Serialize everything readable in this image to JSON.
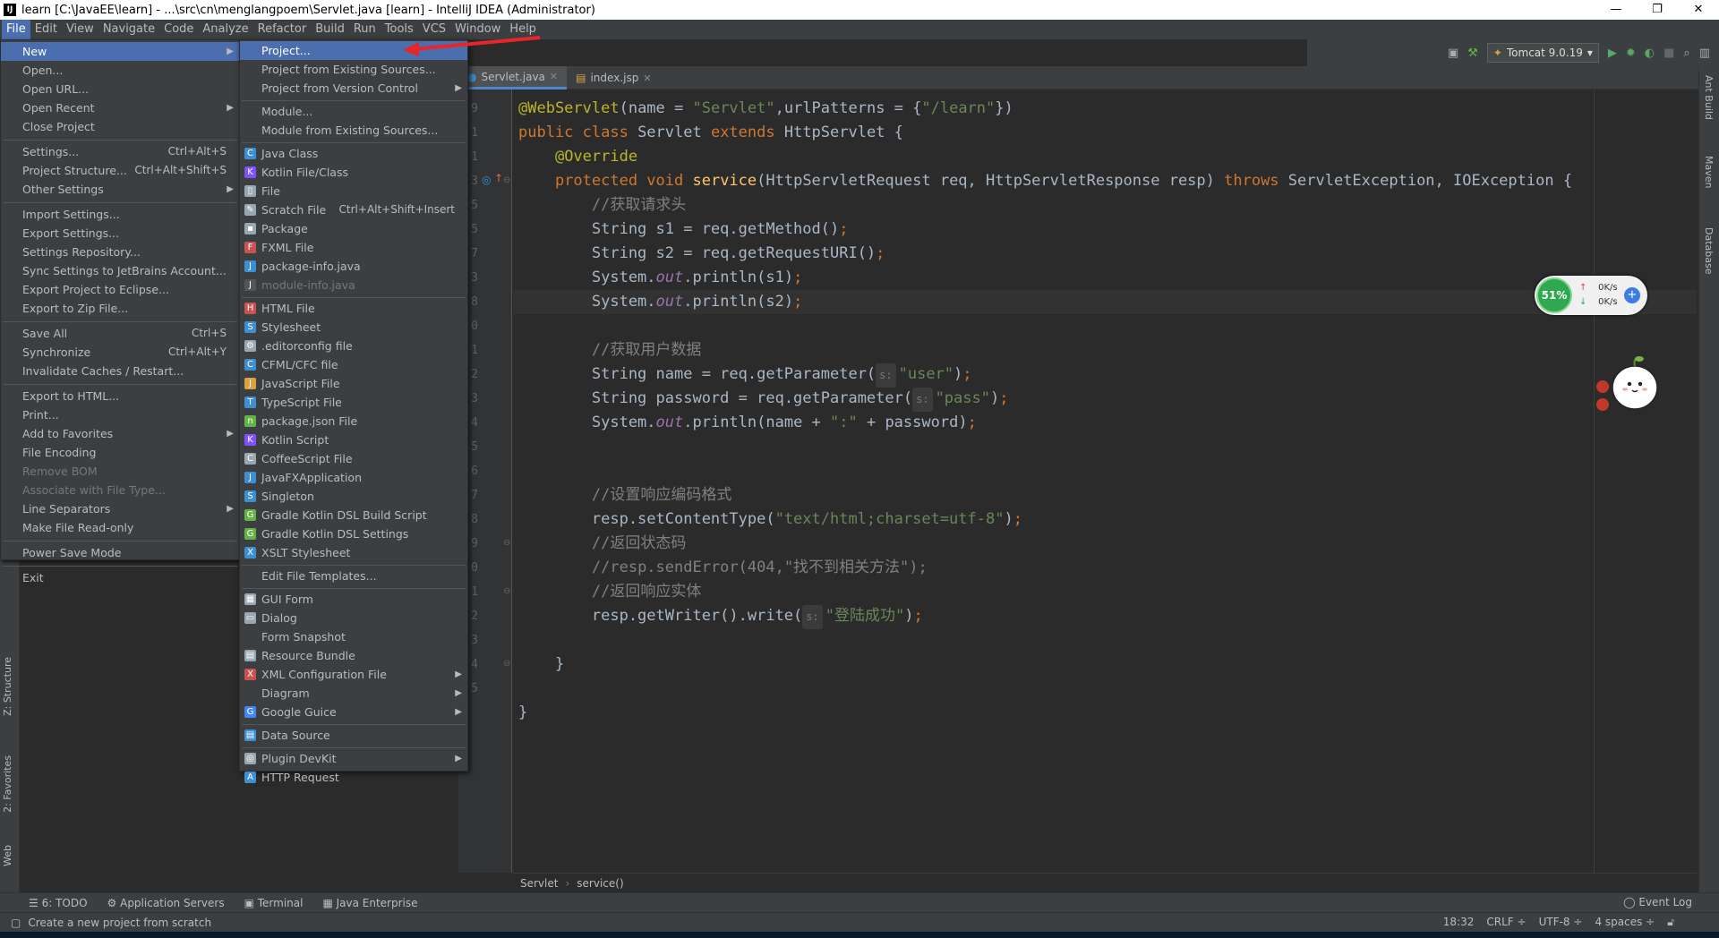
{
  "window": {
    "title": "learn [C:\\JavaEE\\learn] - ...\\src\\cn\\menglangpoem\\Servlet.java [learn] - IntelliJ IDEA (Administrator)",
    "app_icon": "IJ",
    "controls": [
      "—",
      "❐",
      "✕"
    ]
  },
  "menubar": [
    "File",
    "Edit",
    "View",
    "Navigate",
    "Code",
    "Analyze",
    "Refactor",
    "Build",
    "Run",
    "Tools",
    "VCS",
    "Window",
    "Help"
  ],
  "run_config": "Tomcat 9.0.19",
  "tabs": [
    {
      "label": "Servlet.java",
      "selected": true
    },
    {
      "label": "index.jsp",
      "selected": false
    }
  ],
  "file_menu": [
    {
      "label": "New",
      "submenu": true,
      "highlight": true
    },
    {
      "label": "Open..."
    },
    {
      "label": "Open URL..."
    },
    {
      "label": "Open Recent",
      "submenu": true
    },
    {
      "label": "Close Project"
    },
    {
      "sep": true
    },
    {
      "label": "Settings...",
      "shortcut": "Ctrl+Alt+S"
    },
    {
      "label": "Project Structure...",
      "shortcut": "Ctrl+Alt+Shift+S"
    },
    {
      "label": "Other Settings",
      "submenu": true
    },
    {
      "sep": true
    },
    {
      "label": "Import Settings..."
    },
    {
      "label": "Export Settings..."
    },
    {
      "label": "Settings Repository..."
    },
    {
      "label": "Sync Settings to JetBrains Account..."
    },
    {
      "label": "Export Project to Eclipse..."
    },
    {
      "label": "Export to Zip File..."
    },
    {
      "sep": true
    },
    {
      "label": "Save All",
      "shortcut": "Ctrl+S"
    },
    {
      "label": "Synchronize",
      "shortcut": "Ctrl+Alt+Y"
    },
    {
      "label": "Invalidate Caches / Restart..."
    },
    {
      "sep": true
    },
    {
      "label": "Export to HTML..."
    },
    {
      "label": "Print..."
    },
    {
      "label": "Add to Favorites",
      "submenu": true
    },
    {
      "label": "File Encoding"
    },
    {
      "label": "Remove BOM",
      "disabled": true
    },
    {
      "label": "Associate with File Type...",
      "disabled": true
    },
    {
      "label": "Line Separators",
      "submenu": true
    },
    {
      "label": "Make File Read-only"
    },
    {
      "sep": true
    },
    {
      "label": "Power Save Mode"
    },
    {
      "sep": true
    },
    {
      "label": "Exit"
    }
  ],
  "new_menu": [
    {
      "label": "Project...",
      "highlight": true
    },
    {
      "label": "Project from Existing Sources..."
    },
    {
      "label": "Project from Version Control",
      "submenu": true
    },
    {
      "sep": true
    },
    {
      "label": "Module..."
    },
    {
      "label": "Module from Existing Sources..."
    },
    {
      "sep": true
    },
    {
      "label": "Java Class",
      "icon": "C",
      "color": "#3d8fd1"
    },
    {
      "label": "Kotlin File/Class",
      "icon": "K",
      "color": "#7f52ff"
    },
    {
      "label": "File",
      "icon": "▯",
      "color": "#9aa7b0"
    },
    {
      "label": "Scratch File",
      "shortcut": "Ctrl+Alt+Shift+Insert",
      "icon": "✎",
      "color": "#9aa7b0"
    },
    {
      "label": "Package",
      "icon": "▪",
      "color": "#9aa7b0"
    },
    {
      "label": "FXML File",
      "icon": "F",
      "color": "#c75450"
    },
    {
      "label": "package-info.java",
      "icon": "J",
      "color": "#3d8fd1"
    },
    {
      "label": "module-info.java",
      "disabled": true,
      "icon": "J",
      "color": "#555"
    },
    {
      "sep": true
    },
    {
      "label": "HTML File",
      "icon": "H",
      "color": "#c75450"
    },
    {
      "label": "Stylesheet",
      "icon": "S",
      "color": "#3d8fd1"
    },
    {
      "label": ".editorconfig file",
      "icon": "⚙",
      "color": "#9aa7b0"
    },
    {
      "label": "CFML/CFC file",
      "icon": "C",
      "color": "#3d8fd1"
    },
    {
      "label": "JavaScript File",
      "icon": "J",
      "color": "#d9a343"
    },
    {
      "label": "TypeScript File",
      "icon": "T",
      "color": "#3d8fd1"
    },
    {
      "label": "package.json File",
      "icon": "n",
      "color": "#62b543"
    },
    {
      "label": "Kotlin Script",
      "icon": "K",
      "color": "#7f52ff"
    },
    {
      "label": "CoffeeScript File",
      "icon": "C",
      "color": "#9aa7b0"
    },
    {
      "label": "JavaFXApplication",
      "icon": "J",
      "color": "#3d8fd1"
    },
    {
      "label": "Singleton",
      "icon": "S",
      "color": "#3d8fd1"
    },
    {
      "label": "Gradle Kotlin DSL Build Script",
      "icon": "G",
      "color": "#62b543"
    },
    {
      "label": "Gradle Kotlin DSL Settings",
      "icon": "G",
      "color": "#62b543"
    },
    {
      "label": "XSLT Stylesheet",
      "icon": "X",
      "color": "#3d8fd1"
    },
    {
      "sep": true
    },
    {
      "label": "Edit File Templates..."
    },
    {
      "sep": true
    },
    {
      "label": "GUI Form",
      "icon": "▦",
      "color": "#9aa7b0"
    },
    {
      "label": "Dialog",
      "icon": "▭",
      "color": "#9aa7b0"
    },
    {
      "label": "Form Snapshot"
    },
    {
      "label": "Resource Bundle",
      "icon": "▤",
      "color": "#9aa7b0"
    },
    {
      "label": "XML Configuration File",
      "submenu": true,
      "icon": "X",
      "color": "#c75450"
    },
    {
      "label": "Diagram",
      "submenu": true
    },
    {
      "label": "Google Guice",
      "submenu": true,
      "icon": "G",
      "color": "#4285f4"
    },
    {
      "sep": true
    },
    {
      "label": "Data Source",
      "icon": "▤",
      "color": "#3d8fd1"
    },
    {
      "sep": true
    },
    {
      "label": "Plugin DevKit",
      "submenu": true,
      "icon": "◎",
      "color": "#9aa7b0"
    },
    {
      "label": "HTTP Request",
      "icon": "A",
      "color": "#3d8fd1"
    }
  ],
  "editor": {
    "line_numbers": [
      "9",
      "1",
      "1",
      "3",
      "5",
      "5",
      "7",
      "3",
      "8",
      "0",
      "1",
      "2",
      "3",
      "4",
      "5",
      "6",
      "7",
      "8",
      "9",
      "0",
      "1",
      "2",
      "3",
      "4",
      "5"
    ],
    "lines": [
      {
        "tokens": [
          [
            "ann",
            "@WebServlet"
          ],
          [
            "pl",
            "(name = "
          ],
          [
            "str",
            "\"Servlet\""
          ],
          [
            "pl",
            ",urlPatterns = {"
          ],
          [
            "str",
            "\"/learn\""
          ],
          [
            "pl",
            "})"
          ]
        ]
      },
      {
        "tokens": [
          [
            "kw",
            "public class "
          ],
          [
            "pl",
            "Servlet "
          ],
          [
            "kw",
            "extends "
          ],
          [
            "pl",
            "HttpServlet {"
          ]
        ]
      },
      {
        "tokens": [
          [
            "pl",
            "    "
          ],
          [
            "ann",
            "@Override"
          ]
        ]
      },
      {
        "tokens": [
          [
            "pl",
            "    "
          ],
          [
            "kw",
            "protected void "
          ],
          [
            "fn",
            "service"
          ],
          [
            "pl",
            "(HttpServletRequest req, HttpServletResponse resp) "
          ],
          [
            "kw",
            "throws "
          ],
          [
            "pl",
            "ServletException, IOException {"
          ]
        ]
      },
      {
        "tokens": [
          [
            "pl",
            "        "
          ],
          [
            "cm",
            "//获取请求头"
          ]
        ]
      },
      {
        "tokens": [
          [
            "pl",
            "        String s1 = req.getMethod()"
          ],
          [
            "kw",
            ";"
          ]
        ]
      },
      {
        "tokens": [
          [
            "pl",
            "        String s2 = req.getRequestURI()"
          ],
          [
            "kw",
            ";"
          ]
        ]
      },
      {
        "tokens": [
          [
            "pl",
            "        System."
          ],
          [
            "it",
            "out"
          ],
          [
            "pl",
            ".println(s1)"
          ],
          [
            "kw",
            ";"
          ]
        ]
      },
      {
        "tokens": [
          [
            "pl",
            "        System."
          ],
          [
            "it",
            "out"
          ],
          [
            "pl",
            ".println(s2)"
          ],
          [
            "kw",
            ";"
          ]
        ],
        "current": true
      },
      {
        "tokens": []
      },
      {
        "tokens": [
          [
            "pl",
            "        "
          ],
          [
            "cm",
            "//获取用户数据"
          ]
        ]
      },
      {
        "tokens": [
          [
            "pl",
            "        String name = req.getParameter("
          ],
          [
            "hint",
            "s:"
          ],
          [
            "str",
            "\"user\""
          ],
          [
            "pl",
            ")"
          ],
          [
            "kw",
            ";"
          ]
        ]
      },
      {
        "tokens": [
          [
            "pl",
            "        String password = req.getParameter("
          ],
          [
            "hint",
            "s:"
          ],
          [
            "str",
            "\"pass\""
          ],
          [
            "pl",
            ")"
          ],
          [
            "kw",
            ";"
          ]
        ]
      },
      {
        "tokens": [
          [
            "pl",
            "        System."
          ],
          [
            "it",
            "out"
          ],
          [
            "pl",
            ".println(name + "
          ],
          [
            "str",
            "\":\""
          ],
          [
            "pl",
            " + password)"
          ],
          [
            "kw",
            ";"
          ]
        ]
      },
      {
        "tokens": []
      },
      {
        "tokens": []
      },
      {
        "tokens": [
          [
            "pl",
            "        "
          ],
          [
            "cm",
            "//设置响应编码格式"
          ]
        ]
      },
      {
        "tokens": [
          [
            "pl",
            "        resp.setContentType("
          ],
          [
            "str",
            "\"text/html;charset=utf-8\""
          ],
          [
            "pl",
            ")"
          ],
          [
            "kw",
            ";"
          ]
        ]
      },
      {
        "tokens": [
          [
            "pl",
            "        "
          ],
          [
            "cm",
            "//返回状态码"
          ]
        ]
      },
      {
        "tokens": [
          [
            "pl",
            "        "
          ],
          [
            "cm",
            "//resp.sendError(404,\"找不到相关方法\");"
          ]
        ]
      },
      {
        "tokens": [
          [
            "pl",
            "        "
          ],
          [
            "cm",
            "//返回响应实体"
          ]
        ]
      },
      {
        "tokens": [
          [
            "pl",
            "        resp.getWriter().write("
          ],
          [
            "hint",
            "s:"
          ],
          [
            "str",
            "\"登陆成功\""
          ],
          [
            "pl",
            ")"
          ],
          [
            "kw",
            ";"
          ]
        ]
      },
      {
        "tokens": []
      },
      {
        "tokens": [
          [
            "pl",
            "    }"
          ]
        ]
      },
      {
        "tokens": []
      },
      {
        "tokens": [
          [
            "pl",
            "}"
          ]
        ]
      }
    ]
  },
  "breadcrumb": [
    "Servlet",
    "service()"
  ],
  "left_tool_tabs": [
    "Z: Structure",
    "2: Favorites",
    "Web"
  ],
  "right_tool_tabs": [
    "Ant Build",
    "Maven",
    "Database"
  ],
  "bottom_tools": [
    "6: TODO",
    "Application Servers",
    "Terminal",
    "Java Enterprise"
  ],
  "event_log": "Event Log",
  "status": {
    "message": "Create a new project from scratch",
    "position": "18:32",
    "line_sep": "CRLF ÷",
    "encoding": "UTF-8 ÷",
    "indent": "4 spaces ÷"
  },
  "net_widget": {
    "percent": "51%",
    "up": "0K/s",
    "down": "0K/s"
  }
}
